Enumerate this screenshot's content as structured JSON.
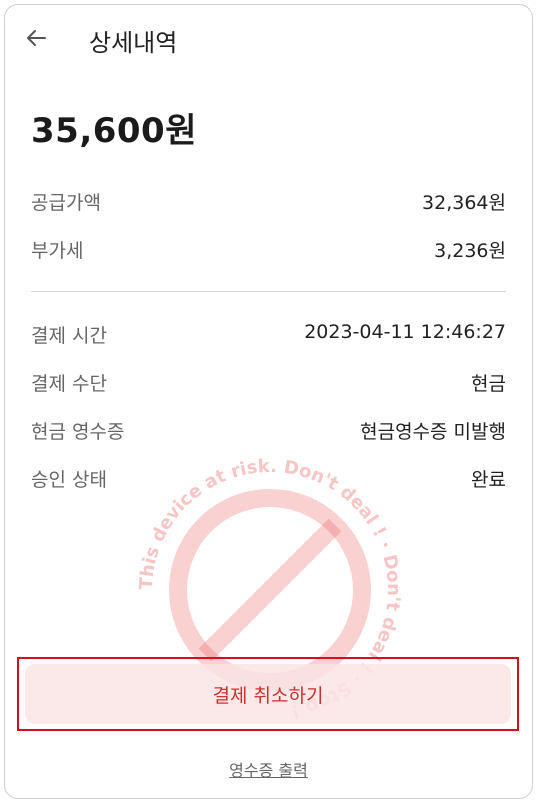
{
  "header": {
    "title": "상세내역"
  },
  "summary": {
    "total": "35,600원"
  },
  "price_rows": [
    {
      "label": "공급가액",
      "value": "32,364원"
    },
    {
      "label": "부가세",
      "value": "3,236원"
    }
  ],
  "detail_rows": [
    {
      "label": "결제 시간",
      "value": "2023-04-11 12:46:27"
    },
    {
      "label": "결제 수단",
      "value": "현금"
    },
    {
      "label": "현금 영수증",
      "value": "현금영수증 미발행"
    },
    {
      "label": "승인 상태",
      "value": "완료"
    }
  ],
  "watermark": {
    "text": "This device at risk. Don't deal ! · Don't deal ! · Stop !",
    "color": "#e85a5a"
  },
  "actions": {
    "cancel_label": "결제 취소하기",
    "receipt_label": "영수증 출력"
  },
  "colors": {
    "accent_red": "#d3111b",
    "cancel_bg": "#fae4e4"
  },
  "icons": {
    "back": "arrow-left-icon"
  }
}
